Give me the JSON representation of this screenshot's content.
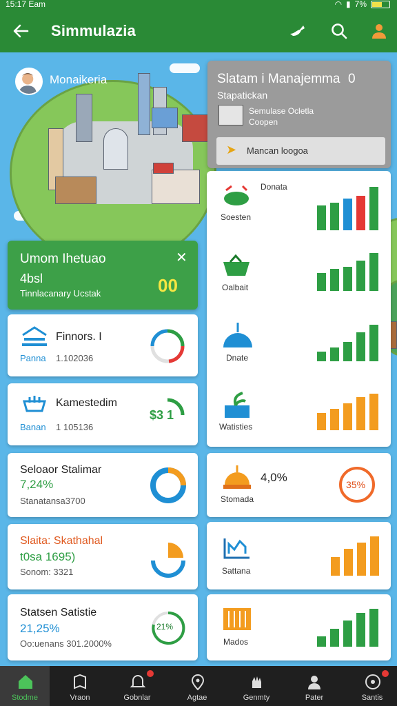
{
  "status_bar": {
    "time": "15:17 Eam",
    "battery": "7%"
  },
  "app_bar": {
    "title": "Simmulazia"
  },
  "profile": {
    "name": "Monaikeria"
  },
  "management": {
    "title": "Slatam i Manajemma",
    "count": "0",
    "subtitle": "Stapatickan",
    "line1": "Semulase Ocletla",
    "line2": "Coopen",
    "button": "Mancan loogoa"
  },
  "highlight": {
    "title": "Umom Ihetuao",
    "value": "4bsl",
    "subtitle": "Tinnlacanary Ucstak",
    "number": "00"
  },
  "left_cards": [
    {
      "title": "Finnors. I",
      "sub_label": "Panna",
      "sub_value": "1.102036"
    },
    {
      "title": "Kamestedim",
      "sub_label": "Banan",
      "sub_value": "1 105136",
      "ring_text": "$3 1"
    },
    {
      "title": "Seloaor Stalimar",
      "percent": "7,24%",
      "sub": "Stanatansa3700"
    },
    {
      "title": "Slaita: Skathahal",
      "percent": "t0sa  1695)",
      "sub": "Sonom: 3321"
    },
    {
      "title": "Statsen Satistie",
      "percent": "21,25%",
      "sub": "Oo:uenans 301.2000%",
      "ring_text": "21%"
    }
  ],
  "right_items": [
    {
      "label": "Soesten",
      "top_label": "Donata",
      "bars": [
        0.55,
        0.6,
        0.7,
        0.75,
        0.95
      ],
      "colors": [
        "#2e9e44",
        "#2e9e44",
        "#1f8fd4",
        "#e53935",
        "#2e9e44"
      ]
    },
    {
      "label": "Oalbait",
      "bars": [
        0.45,
        0.55,
        0.6,
        0.75,
        0.95
      ],
      "colors": [
        "#2e9e44",
        "#2e9e44",
        "#2e9e44",
        "#2e9e44",
        "#2e9e44"
      ]
    },
    {
      "label": "Dnate",
      "bars": [
        0.25,
        0.35,
        0.5,
        0.75,
        0.95
      ],
      "colors": [
        "#2e9e44",
        "#2e9e44",
        "#2e9e44",
        "#2e9e44",
        "#2e9e44"
      ]
    },
    {
      "label": "Watisties",
      "bars": [
        0.45,
        0.55,
        0.7,
        0.85,
        0.95
      ],
      "colors": [
        "#f39c1f",
        "#f39c1f",
        "#f39c1f",
        "#f39c1f",
        "#f39c1f"
      ]
    },
    {
      "label": "Stomada",
      "value": "4,0%",
      "ring_text": "35%"
    },
    {
      "label": "Sattana",
      "bars": [
        0.45,
        0.65,
        0.8,
        0.95
      ],
      "colors": [
        "#f39c1f",
        "#f39c1f",
        "#f39c1f",
        "#f39c1f"
      ]
    },
    {
      "label": "Mados",
      "bars": [
        0.25,
        0.45,
        0.65,
        0.85,
        0.95
      ],
      "colors": [
        "#2e9e44",
        "#2e9e44",
        "#2e9e44",
        "#2e9e44",
        "#2e9e44"
      ]
    }
  ],
  "nav": [
    {
      "label": "Stodme",
      "icon": "home-icon",
      "active": true
    },
    {
      "label": "Vraon",
      "icon": "map-icon"
    },
    {
      "label": "Gobnlar",
      "icon": "bell-icon",
      "badge": true
    },
    {
      "label": "Agtae",
      "icon": "pin-icon"
    },
    {
      "label": "Genmty",
      "icon": "hand-icon"
    },
    {
      "label": "Pater",
      "icon": "user-icon"
    },
    {
      "label": "Santis",
      "icon": "settings-icon",
      "badge": true
    }
  ],
  "colors": {
    "primary": "#2a8a36",
    "accent_green": "#3da048",
    "blue": "#1f8fd4",
    "orange": "#f39c1f",
    "red": "#e53935"
  }
}
